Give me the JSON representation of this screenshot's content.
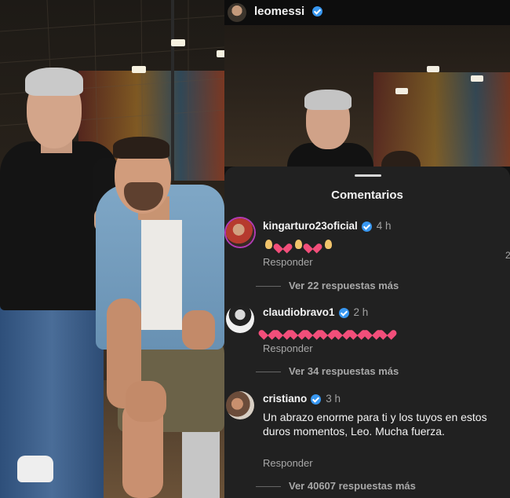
{
  "post": {
    "username": "leomessi"
  },
  "comments_sheet": {
    "title": "Comentarios",
    "reply_label": "Responder",
    "comments": [
      {
        "username": "kingarturo23oficial",
        "verified": true,
        "time": "4 h",
        "emojis": [
          "pray",
          "heart",
          "pray",
          "heart",
          "pray"
        ],
        "more_replies": "Ver 22 respuestas más"
      },
      {
        "username": "claudiobravo1",
        "verified": true,
        "time": "2 h",
        "emojis": [
          "heart",
          "heart",
          "heart",
          "heart",
          "heart",
          "heart",
          "heart",
          "heart",
          "heart"
        ],
        "more_replies": "Ver 34 respuestas más"
      },
      {
        "username": "cristiano",
        "verified": true,
        "time": "3 h",
        "text": "Un abrazo enorme para ti y los tuyos en estos duros momentos, Leo. Mucha fuerza.",
        "more_replies": "Ver 40607 respuestas más"
      }
    ],
    "edge_counter": "2"
  },
  "colors": {
    "verified_blue": "#3897f0",
    "sheet_bg": "#212121",
    "heart": "#f24e7a"
  }
}
